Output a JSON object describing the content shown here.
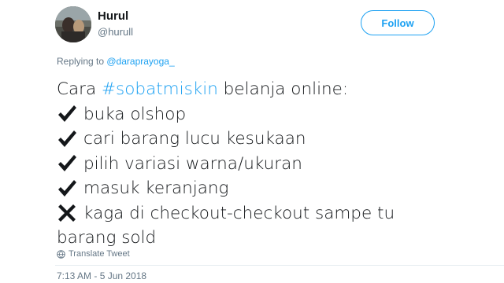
{
  "author": {
    "name": "Hurul",
    "handle": "@hurull"
  },
  "follow_label": "Follow",
  "replying": {
    "prefix": "Replying to ",
    "mention": "@daraprayoga_"
  },
  "text": {
    "intro_before": "Cara ",
    "hashtag": "#sobatmiskin",
    "intro_after": " belanja online:",
    "items": [
      {
        "mark": "check",
        "text": "buka olshop"
      },
      {
        "mark": "check",
        "text": "cari barang lucu kesukaan"
      },
      {
        "mark": "check",
        "text": "pilih variasi warna/ukuran"
      },
      {
        "mark": "check",
        "text": "masuk keranjang"
      },
      {
        "mark": "cross",
        "text": "kaga di checkout-checkout sampe tu"
      }
    ],
    "continuation": "barang sold"
  },
  "translate_label": "Translate Tweet",
  "timestamp": "7:13 AM - 5 Jun 2018",
  "colors": {
    "link": "#1da1f2",
    "secondary": "#657786",
    "text": "#14171a"
  },
  "icons": {
    "check": "heavy-check-mark-icon",
    "cross": "heavy-cross-mark-icon",
    "globe": "globe-icon"
  }
}
